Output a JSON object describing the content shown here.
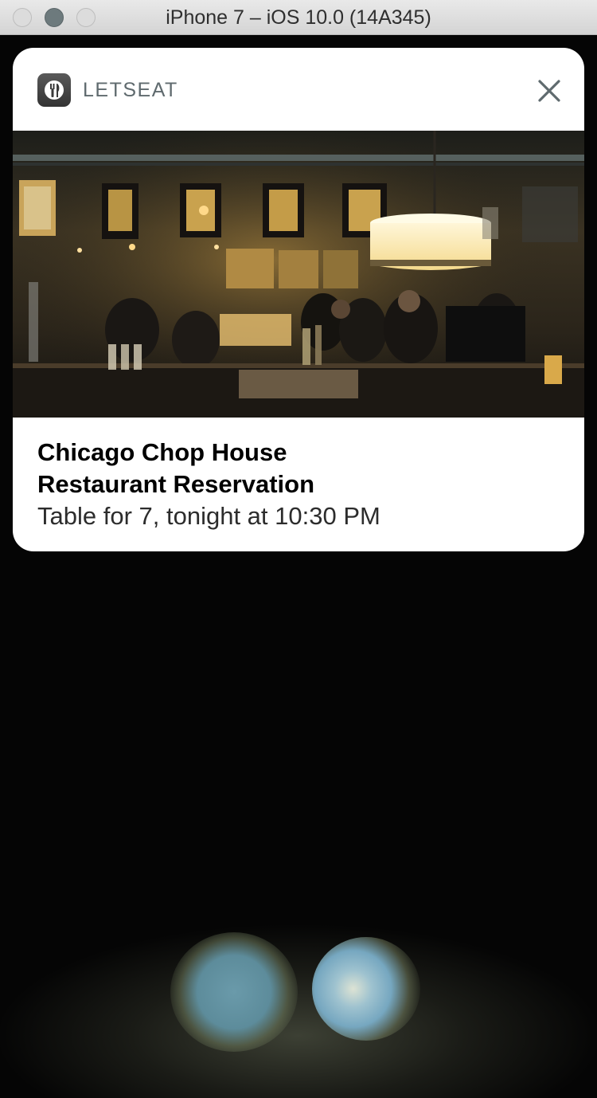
{
  "window": {
    "title": "iPhone 7 – iOS 10.0 (14A345)"
  },
  "notification": {
    "app_name": "LETSEAT",
    "title_line1": "Chicago Chop House",
    "title_line2": "Restaurant Reservation",
    "body": "Table for 7, tonight at 10:30 PM",
    "icons": {
      "app": "letseat-app-icon",
      "close": "close-icon"
    }
  },
  "colors": {
    "card": "#ffffff",
    "background": "#050505",
    "app_name": "#5f6a6e"
  }
}
